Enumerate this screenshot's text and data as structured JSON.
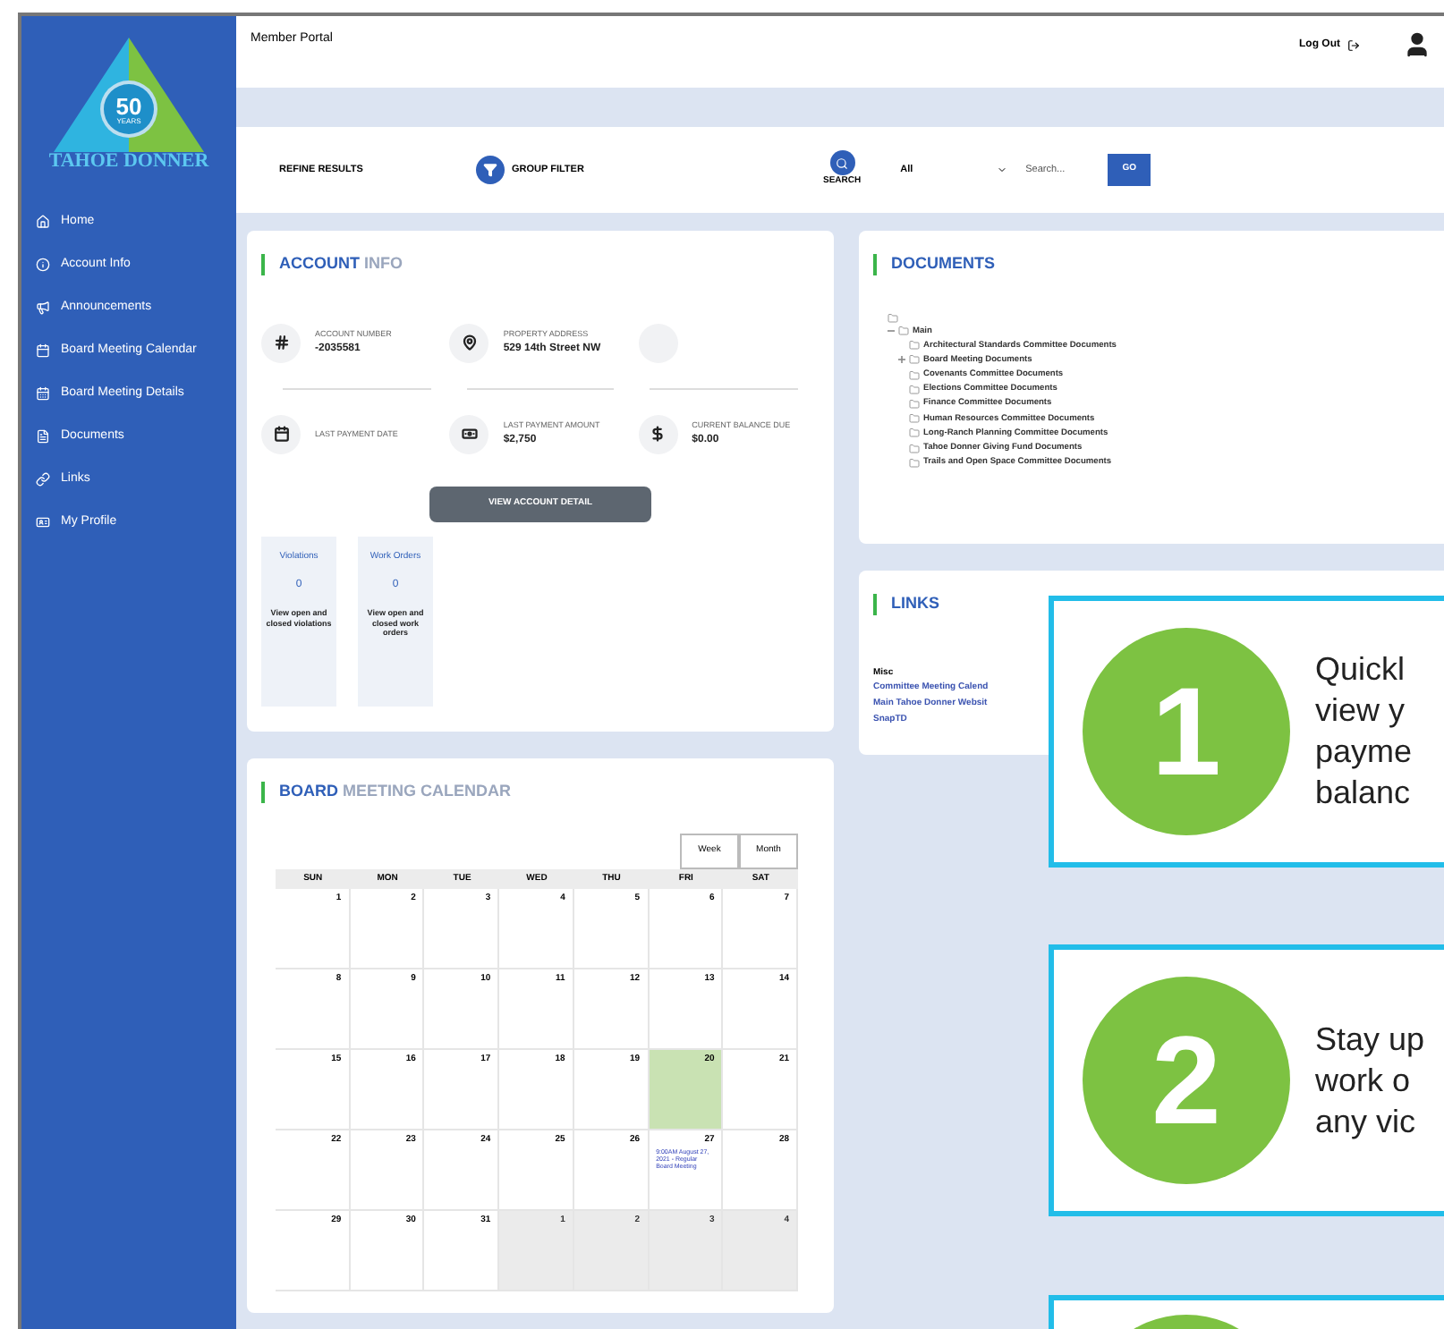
{
  "logo": {
    "number": "50",
    "caption": "YEARS",
    "name": "TAHOE DONNER"
  },
  "sidebar": {
    "items": [
      {
        "kind": "home",
        "label": "Home"
      },
      {
        "kind": "info",
        "label": "Account Info"
      },
      {
        "kind": "announce",
        "label": "Announcements"
      },
      {
        "kind": "calendar",
        "label": "Board Meeting Calendar"
      },
      {
        "kind": "details",
        "label": "Board Meeting Details"
      },
      {
        "kind": "document",
        "label": "Documents"
      },
      {
        "kind": "link",
        "label": "Links"
      },
      {
        "kind": "profile",
        "label": "My Profile"
      }
    ]
  },
  "header": {
    "title": "Member Portal",
    "logout": "Log Out"
  },
  "filter_bar": {
    "refine": "REFINE RESULTS",
    "group_filter": "GROUP FILTER",
    "search_label": "SEARCH",
    "scope": "All",
    "placeholder": "Search...",
    "go": "GO"
  },
  "account_info": {
    "title_strong": "ACCOUNT",
    "title_rest": "INFO",
    "stats": [
      {
        "kind": "number",
        "label": "ACCOUNT NUMBER",
        "value": "-2035581"
      },
      {
        "kind": "address",
        "label": "PROPERTY ADDRESS",
        "value": "529 14th Street NW"
      },
      {
        "kind": "empty"
      },
      {
        "kind": "date",
        "label": "LAST PAYMENT DATE"
      },
      {
        "kind": "payment",
        "label": "LAST PAYMENT AMOUNT",
        "value": "$2,750"
      },
      {
        "kind": "balance",
        "label": "CURRENT BALANCE DUE",
        "value": "$0.00"
      }
    ],
    "button": "VIEW ACCOUNT DETAIL",
    "tiles": [
      {
        "title": "Violations",
        "count": "0",
        "text": "View open and closed violations"
      },
      {
        "title": "Work Orders",
        "count": "0",
        "text": "View open and closed work orders"
      }
    ]
  },
  "calendar": {
    "title_strong": "BOARD",
    "title_rest": "MEETING CALENDAR",
    "views": [
      "Week",
      "Month"
    ],
    "weekdays": [
      "SUN",
      "MON",
      "TUE",
      "WED",
      "THU",
      "FRI",
      "SAT"
    ],
    "days": [
      {
        "label": "1",
        "today": false,
        "other_month": false
      },
      {
        "label": "2",
        "today": false,
        "other_month": false
      },
      {
        "label": "3",
        "today": false,
        "other_month": false
      },
      {
        "label": "4",
        "today": false,
        "other_month": false
      },
      {
        "label": "5",
        "today": false,
        "other_month": false
      },
      {
        "label": "6",
        "today": false,
        "other_month": false
      },
      {
        "label": "7",
        "today": false,
        "other_month": false
      },
      {
        "label": "8",
        "today": false,
        "other_month": false
      },
      {
        "label": "9",
        "today": false,
        "other_month": false
      },
      {
        "label": "10",
        "today": false,
        "other_month": false
      },
      {
        "label": "11",
        "today": false,
        "other_month": false
      },
      {
        "label": "12",
        "today": false,
        "other_month": false
      },
      {
        "label": "13",
        "today": false,
        "other_month": false
      },
      {
        "label": "14",
        "today": false,
        "other_month": false
      },
      {
        "label": "15",
        "today": false,
        "other_month": false
      },
      {
        "label": "16",
        "today": false,
        "other_month": false
      },
      {
        "label": "17",
        "today": false,
        "other_month": false
      },
      {
        "label": "18",
        "today": false,
        "other_month": false
      },
      {
        "label": "19",
        "today": false,
        "other_month": false
      },
      {
        "label": "20",
        "today": true,
        "other_month": false
      },
      {
        "label": "21",
        "today": false,
        "other_month": false
      },
      {
        "label": "22",
        "today": false,
        "other_month": false
      },
      {
        "label": "23",
        "today": false,
        "other_month": false
      },
      {
        "label": "24",
        "today": false,
        "other_month": false
      },
      {
        "label": "25",
        "today": false,
        "other_month": false
      },
      {
        "label": "26",
        "today": false,
        "other_month": false
      },
      {
        "label": "27",
        "today": false,
        "other_month": false,
        "event": "9:00AM August 27, 2021 - Regular Board Meeting"
      },
      {
        "label": "28",
        "today": false,
        "other_month": false
      },
      {
        "label": "29",
        "today": false,
        "other_month": false
      },
      {
        "label": "30",
        "today": false,
        "other_month": false
      },
      {
        "label": "31",
        "today": false,
        "other_month": false
      },
      {
        "label": "1",
        "today": false,
        "other_month": true
      },
      {
        "label": "2",
        "today": false,
        "other_month": true
      },
      {
        "label": "3",
        "today": false,
        "other_month": true
      },
      {
        "label": "4",
        "today": false,
        "other_month": true
      }
    ]
  },
  "documents": {
    "title": "DOCUMENTS",
    "tree": {
      "label": "Main",
      "expanded": true,
      "children": [
        {
          "label": "Architectural Standards Committee Documents",
          "kind": "leaf"
        },
        {
          "label": "Board Meeting Documents",
          "kind": "group"
        },
        {
          "label": "Covenants Committee Documents",
          "kind": "leaf"
        },
        {
          "label": "Elections Committee Documents",
          "kind": "leaf"
        },
        {
          "label": "Finance Committee Documents",
          "kind": "leaf"
        },
        {
          "label": "Human Resources Committee Documents",
          "kind": "leaf"
        },
        {
          "label": "Long-Ranch Planning Committee Documents",
          "kind": "leaf"
        },
        {
          "label": "Tahoe Donner Giving Fund Documents",
          "kind": "leaf"
        },
        {
          "label": "Trails and Open Space Committee Documents",
          "kind": "leaf"
        }
      ]
    }
  },
  "links": {
    "title": "LINKS",
    "group": "Misc",
    "items": [
      "Committee Meeting Calend",
      "Main Tahoe Donner Websit",
      "SnapTD"
    ]
  },
  "callouts": [
    {
      "kind": "full",
      "number": "1",
      "lines": [
        "Quickl",
        "view y",
        "payme",
        "balanc"
      ]
    },
    {
      "kind": "full",
      "number": "2",
      "lines": [
        "Stay up",
        "work o",
        "any vic"
      ]
    },
    {
      "kind": "cut"
    }
  ]
}
